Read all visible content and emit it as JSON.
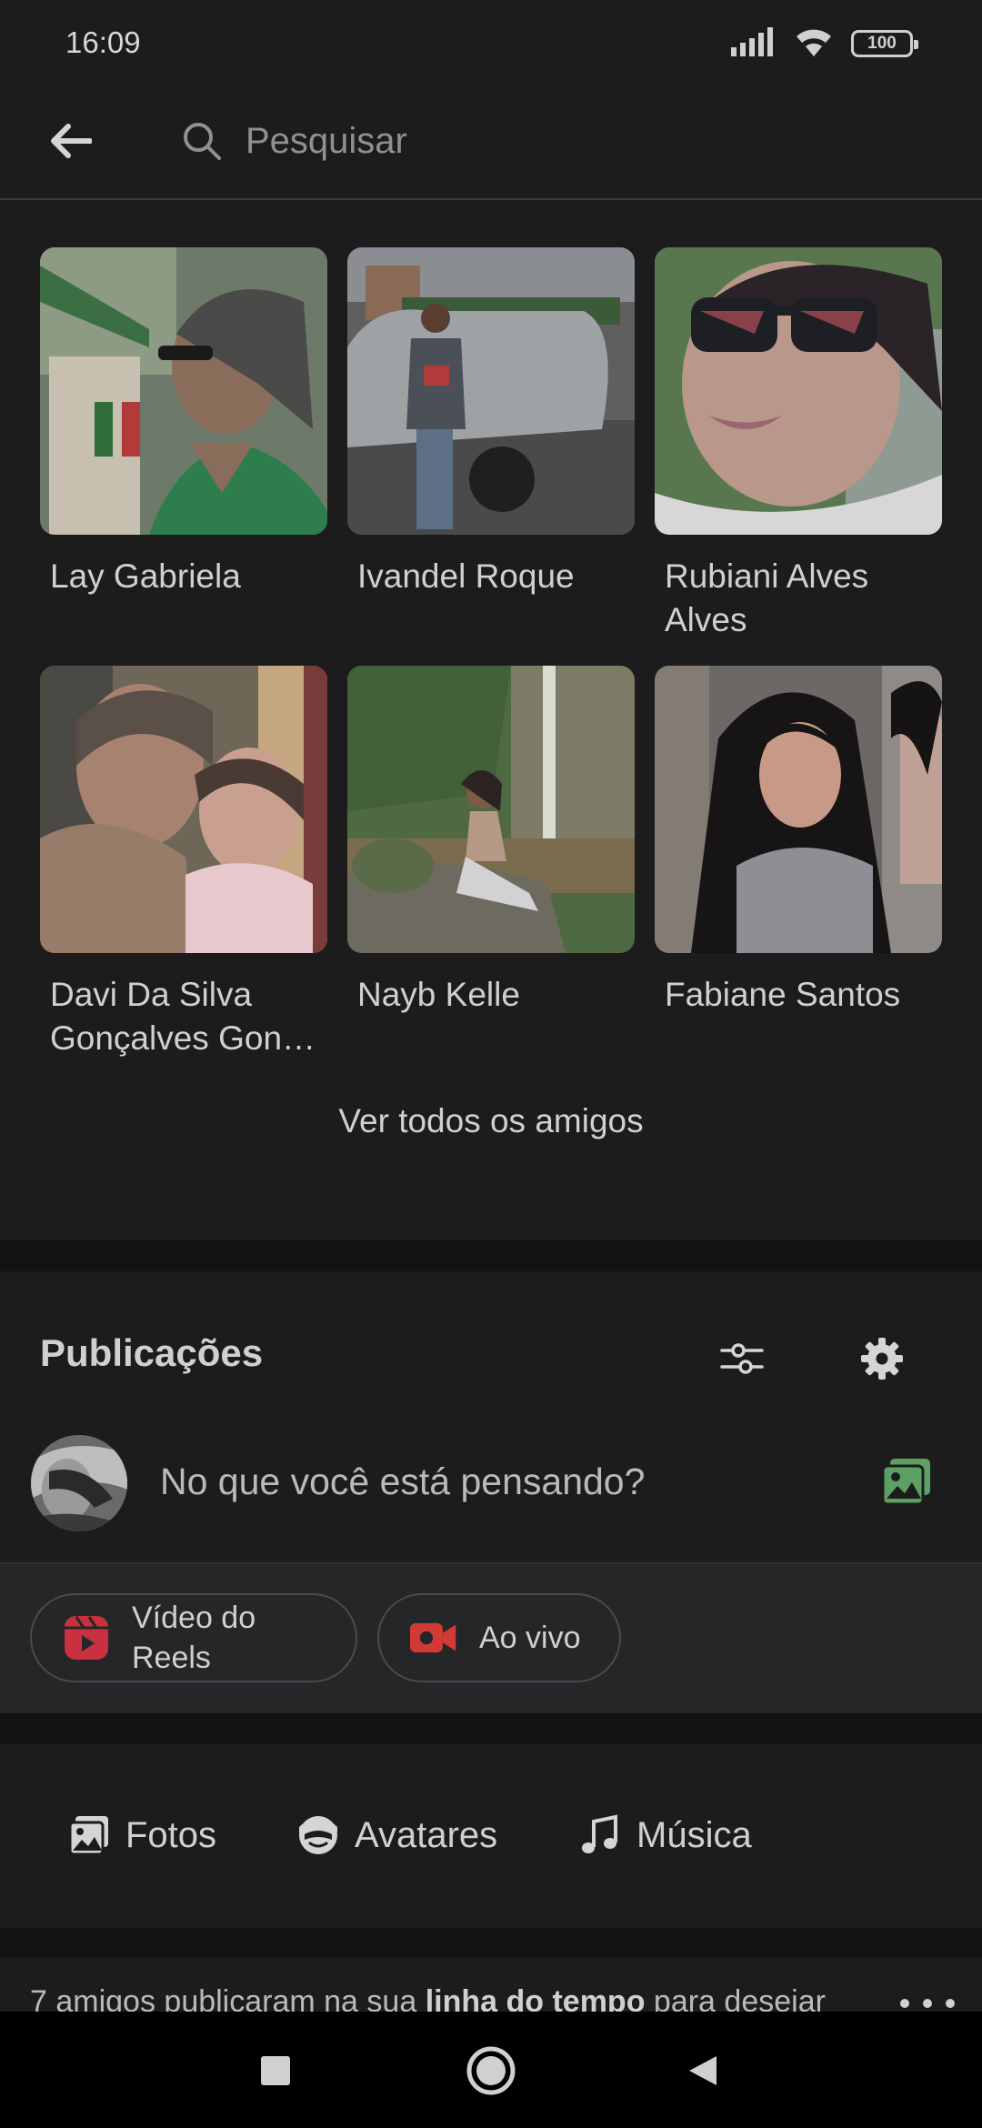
{
  "status_bar": {
    "time": "16:09",
    "battery": "100"
  },
  "header": {
    "search_placeholder": "Pesquisar"
  },
  "friends": {
    "peek_text": "…",
    "items": [
      {
        "name": "Lay Gabriela"
      },
      {
        "name": "Ivandel Roque"
      },
      {
        "name": "Rubiani Alves Alves"
      },
      {
        "name": "Davi Da Silva Gonçalves Gon…"
      },
      {
        "name": "Nayb Kelle"
      },
      {
        "name": "Fabiane Santos"
      }
    ],
    "see_all": "Ver todos os amigos"
  },
  "posts": {
    "title": "Publicações",
    "composer_placeholder": "No que você está pensando?",
    "chips": {
      "reels": "Vídeo do Reels",
      "live": "Ao vivo"
    }
  },
  "tabs": {
    "photos": "Fotos",
    "avatars": "Avatares",
    "music": "Música"
  },
  "feed": {
    "text_prefix": "7 amigos publicaram na sua ",
    "text_bold": "linha do tempo",
    "text_suffix": " para desejar"
  },
  "colors": {
    "background": "#1c1c1d",
    "separator": "#131314",
    "reels_red": "#c8313f",
    "live_red": "#d33a35",
    "photo_green": "#5ca064"
  }
}
